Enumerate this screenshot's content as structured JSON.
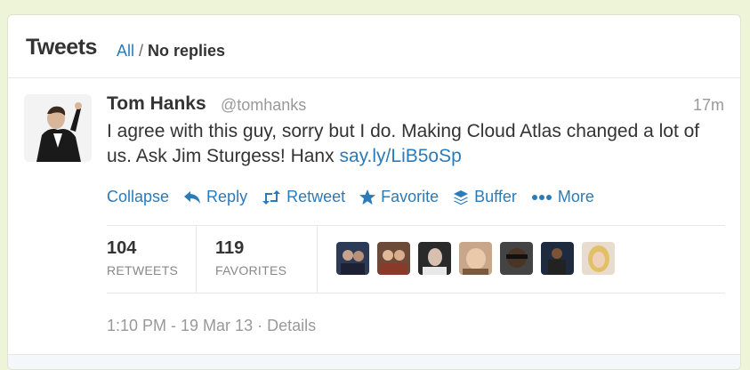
{
  "header": {
    "title": "Tweets",
    "filter_all": "All",
    "filter_sep": " / ",
    "filter_noreplies": "No replies"
  },
  "tweet": {
    "name": "Tom Hanks",
    "handle": "@tomhanks",
    "time": "17m",
    "text": "I agree with this guy, sorry but I do. Making Cloud Atlas changed a lot of us. Ask Jim Sturgess!  Hanx ",
    "link": "say.ly/LiB5oSp",
    "actions": {
      "collapse": "Collapse",
      "reply": "Reply",
      "retweet": "Retweet",
      "favorite": "Favorite",
      "buffer": "Buffer",
      "more": "More"
    },
    "stats": {
      "retweets_count": "104",
      "retweets_label": "RETWEETS",
      "favorites_count": "119",
      "favorites_label": "FAVORITES"
    },
    "favoriters_count": 7,
    "timestamp": "1:10 PM - 19 Mar 13",
    "meta_sep": " · ",
    "details": "Details"
  },
  "colors": {
    "link": "#2b7bb9",
    "background": "#edf4d8",
    "muted": "#999999"
  }
}
